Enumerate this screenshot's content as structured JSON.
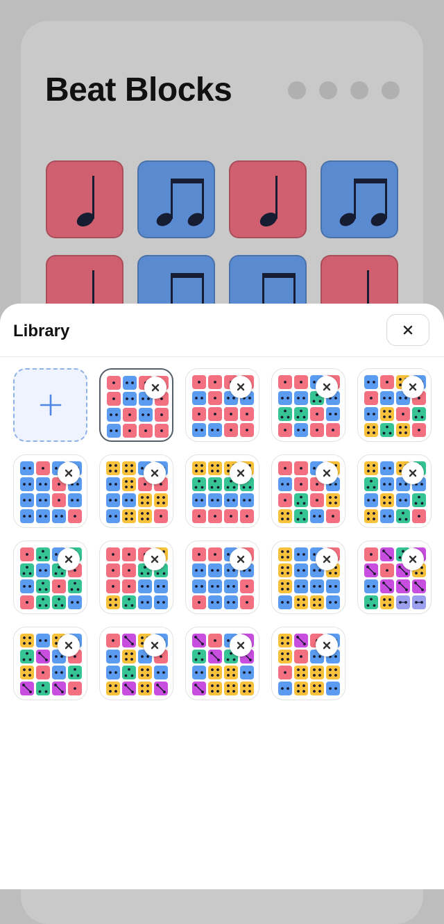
{
  "app": {
    "title": "Beat Blocks"
  },
  "colors": {
    "red": "#d05f70",
    "blue": "#5a8ad0",
    "note_ink": "#161d33"
  },
  "page_dots_icon": "dot",
  "beats": [
    {
      "color": "red",
      "note": "quarter-note-icon"
    },
    {
      "color": "blue",
      "note": "eighth-pair-icon"
    },
    {
      "color": "red",
      "note": "quarter-note-icon"
    },
    {
      "color": "blue",
      "note": "eighth-pair-icon"
    },
    {
      "color": "red",
      "note": "quarter-note-icon"
    },
    {
      "color": "blue",
      "note": "eighth-pair-icon"
    },
    {
      "color": "blue",
      "note": "eighth-pair-icon"
    },
    {
      "color": "red",
      "note": "quarter-note-icon"
    }
  ],
  "library": {
    "title": "Library",
    "close_icon": "close-icon",
    "add_icon": "plus-icon",
    "delete_icon": "close-icon",
    "cell_colors": {
      "r": "#f2707f",
      "b": "#5b9cf0",
      "y": "#f8c23c",
      "g": "#36c494",
      "p": "#c84ee0",
      "v": "#9aa0ee"
    },
    "presets": [
      [
        "r1b2r1r1",
        "r1b2b2r1",
        "b2r1b2r1",
        "b2r1r1r1"
      ],
      [
        "r1r1r1r1",
        "b2r1b2b2",
        "r1r1r1r1",
        "b2b2r1r1"
      ],
      [
        "r1r1b2r1",
        "b2b2g3b2",
        "g3g3r1b2",
        "r1b2r1r1"
      ],
      [
        "b2r1y4b2",
        "r1b2b2r1",
        "b2y4r1g3",
        "y4g3y4r1"
      ],
      [
        "b2r1b2b2",
        "b2b2r1b2",
        "b2b2r1b2",
        "b2b2b2r1"
      ],
      [
        "y4y4b2b2",
        "b2y4r1r1",
        "b2b2y4y4",
        "b2y4y4r1"
      ],
      [
        "y4y4y4y4",
        "g3g3g3g3",
        "b2b2b2b2",
        "r1r1r1r1"
      ],
      [
        "r1r1b2y4",
        "b2r1r1b2",
        "r1g3r1y4",
        "y4g3b2r1"
      ],
      [
        "y4b2y4g3",
        "g3b2b2b2",
        "b2y4b2g3",
        "y4b2g3r1"
      ],
      [
        "r1g3b2g3",
        "g3b2g3r1",
        "b2g3r1g3",
        "r1g3g3b2"
      ],
      [
        "r1r1r1y4",
        "r1r1g3g3",
        "r1r1b2b2",
        "y4g3b2b2"
      ],
      [
        "r1r1b2r1",
        "b2b2b2b2",
        "b2b2b2r1",
        "r1b2b2r1"
      ],
      [
        "y4b2b2r1",
        "y4b2b2y4",
        "y4b2b2b2",
        "b2y4y4b2"
      ],
      [
        "r1p5g3p5",
        "p5r1p5y4",
        "b2p5p5p5",
        "g3y4v2v2"
      ],
      [
        "y4b2y4b2",
        "g3p5b2r1",
        "y4r1b2g3",
        "p5g3p5r1"
      ],
      [
        "r1p5y4b2",
        "b2y4b2r1",
        "b2g3y4b2",
        "y4p5y4p5"
      ],
      [
        "p5r1b2p5",
        "g3p5g3p5",
        "b2y4y4b2",
        "p5y4y4y4"
      ],
      [
        "y4p5r1b2",
        "y4r1b2b2",
        "r1y4y4y4",
        "b2y4y4b2"
      ]
    ]
  }
}
